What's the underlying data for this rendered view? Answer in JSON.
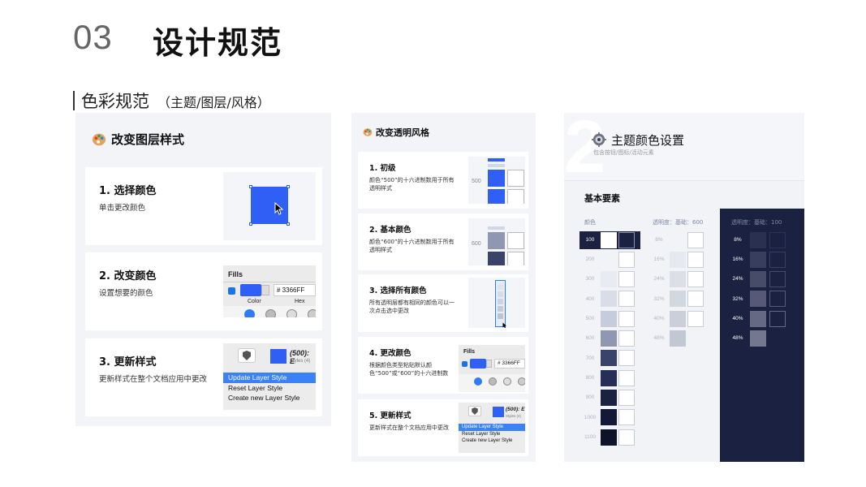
{
  "header": {
    "number": "03",
    "title": "设计规范"
  },
  "subheader": {
    "title": "色彩规范",
    "paren": "（主题/图层/风格）"
  },
  "panel1": {
    "title": "改变图层样式",
    "cards": [
      {
        "title": "1. 选择颜色",
        "desc": "单击更改颜色"
      },
      {
        "title": "2. 改变颜色",
        "desc": "设置想要的颜色"
      },
      {
        "title": "3. 更新样式",
        "desc": "更新样式在整个文档应用中更改"
      }
    ],
    "fills_label": "Fills",
    "hex_value": "# 3366FF",
    "color_label": "Color",
    "hex_label": "Hex",
    "layer_name": "(500): E",
    "layer_sub": "Styles (4)",
    "menu": [
      "Update Layer Style",
      "Reset Layer Style",
      "Create new Layer Style"
    ]
  },
  "panel2": {
    "title": "改变透明风格",
    "cards": [
      {
        "title": "1. 初级",
        "desc": "颜色“500”的十六进制数用于所有透明样式",
        "label": "500"
      },
      {
        "title": "2. 基本颜色",
        "desc": "颜色“600”的十六进制数用于所有透明样式",
        "label": "600"
      },
      {
        "title": "3. 选择所有颜色",
        "desc": "所有透明层都有相同的颜色可以一次点击选中更改",
        "label": ""
      },
      {
        "title": "4. 更改颜色",
        "desc": "根据颜色类型粘贴默认颜色“500”或“600”的十六进制数",
        "label": ""
      },
      {
        "title": "5. 更新样式",
        "desc": "更新样式在整个文档应用中更改",
        "label": ""
      }
    ],
    "fills_label": "Fills",
    "hex_value": "# 3366FF",
    "layer_name": "(500): E",
    "layer_sub": "Styles (4)",
    "menu": [
      "Update Layer Style",
      "Reset Layer Style",
      "Create new Layer Style"
    ]
  },
  "panel3": {
    "big_number": "2",
    "title": "主题颜色设置",
    "subtitle": "包含按钮/图标/活动元素",
    "section": "基本要素",
    "col_color": "颜色",
    "col_opacity_light": "透明度：基础：600",
    "col_opacity_dark": "透明度：基础：100",
    "color_rows": [
      "100",
      "200",
      "300",
      "400",
      "500",
      "600",
      "700",
      "800",
      "900",
      "1000",
      "1100"
    ],
    "opacity_rows": [
      "8%",
      "16%",
      "24%",
      "32%",
      "40%",
      "48%"
    ],
    "colors": {
      "c100": "#1b2140",
      "c200": "#f1f3f7",
      "c300": "#e8ebf1",
      "c400": "#d8dde8",
      "c500": "#c6ccdb",
      "c600": "#8f98b0",
      "c700": "#3a4369",
      "c800": "#262e55",
      "c900": "#1b2140",
      "c1000": "#141a35",
      "c1100": "#0e1329",
      "accent": "#2f5ff5",
      "dark_panel": "#1b2140"
    }
  }
}
